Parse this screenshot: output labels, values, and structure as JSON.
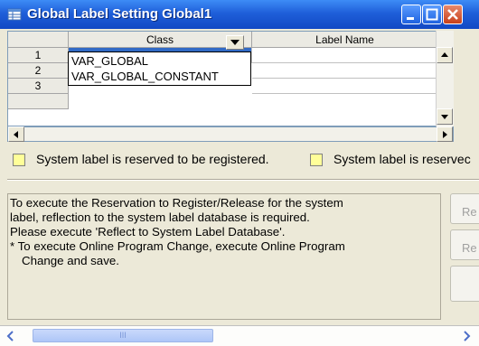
{
  "window": {
    "title": "Global Label Setting Global1",
    "title_icon": "table-icon",
    "buttons": [
      "minimize-icon",
      "maximize-icon",
      "close-icon"
    ]
  },
  "grid": {
    "columns": [
      "",
      "Class",
      "Label Name"
    ],
    "rows": [
      {
        "number": "1",
        "class": "",
        "label": ""
      },
      {
        "number": "2",
        "class": "",
        "label": ""
      },
      {
        "number": "3",
        "class": "",
        "label": ""
      }
    ],
    "dropdown_options": [
      "VAR_GLOBAL",
      "VAR_GLOBAL_CONSTANT"
    ]
  },
  "legend": {
    "item1": "System label is reserved to be registered.",
    "item2": "System label is reservec"
  },
  "message": {
    "lines": [
      "To execute the Reservation to Register/Release for the system",
      "label, reflection to the system label database is required.",
      "Please execute 'Reflect to System Label Database'.",
      "* To execute Online Program Change, execute Online Program",
      "Change and save."
    ]
  },
  "side_buttons": {
    "btn1": "Re",
    "btn2": "Re"
  },
  "colors": {
    "title_bar": "#1f5fd9",
    "selection": "#316ac5",
    "legend_swatch": "#ffff99",
    "scroll_thumb": "#aec6f7"
  },
  "bottom_scroll_thumb": "III"
}
